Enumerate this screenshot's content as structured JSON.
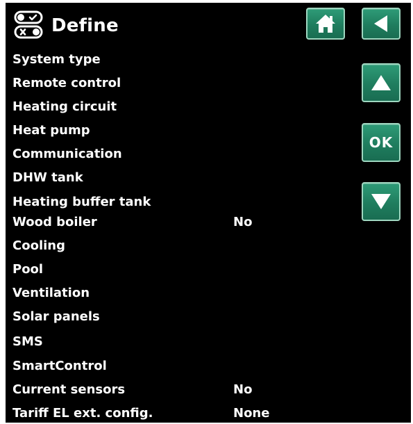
{
  "header": {
    "title": "Define",
    "icon": "toggle-switches-icon",
    "home_icon": "home-icon",
    "back_icon": "back-arrow-icon"
  },
  "nav": {
    "up_icon": "arrow-up-icon",
    "ok_label": "OK",
    "down_icon": "arrow-down-icon"
  },
  "menu": {
    "items": [
      {
        "label": "System type",
        "value": ""
      },
      {
        "label": "Remote control",
        "value": ""
      },
      {
        "label": "Heating circuit",
        "value": ""
      },
      {
        "label": "Heat pump",
        "value": ""
      },
      {
        "label": "Communication",
        "value": ""
      },
      {
        "label": "DHW tank",
        "value": ""
      },
      {
        "label": "Heating buffer tank",
        "value": ""
      },
      {
        "label": "Wood boiler",
        "value": "No"
      },
      {
        "label": "Cooling",
        "value": ""
      },
      {
        "label": "Pool",
        "value": ""
      },
      {
        "label": "Ventilation",
        "value": ""
      },
      {
        "label": "Solar panels",
        "value": ""
      },
      {
        "label": "SMS",
        "value": ""
      },
      {
        "label": "SmartControl",
        "value": ""
      },
      {
        "label": "Current sensors",
        "value": "No"
      },
      {
        "label": "Tariff EL ext. config.",
        "value": "None"
      }
    ]
  },
  "colors": {
    "background": "#000000",
    "text": "#ffffff",
    "button": "#1f7d5e",
    "button_border": "#9fd7c0"
  }
}
